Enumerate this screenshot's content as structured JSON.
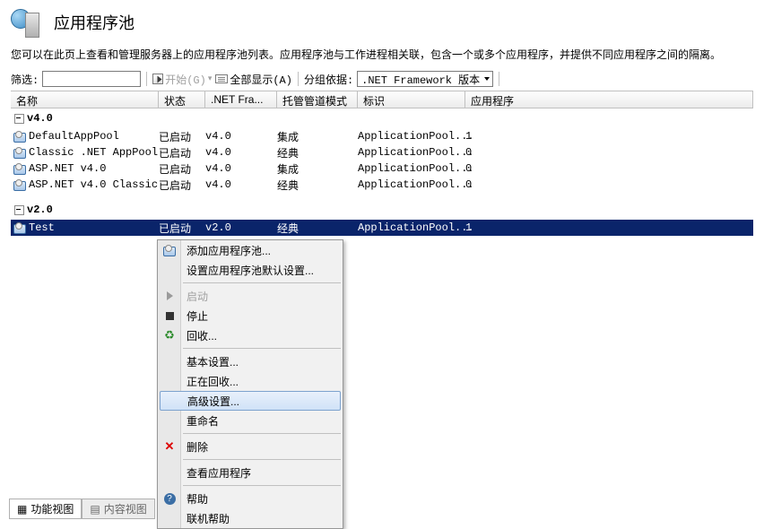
{
  "header": {
    "title": "应用程序池"
  },
  "description": "您可以在此页上查看和管理服务器上的应用程序池列表。应用程序池与工作进程相关联，包含一个或多个应用程序，并提供不同应用程序之间的隔离。",
  "toolbar": {
    "filter_label": "筛选:",
    "go_label": "开始(G)",
    "showall_label": "全部显示(A)",
    "groupby_label": "分组依据:",
    "groupby_value": ".NET Framework 版本"
  },
  "columns": {
    "name": "名称",
    "status": "状态",
    "net": ".NET Fra...",
    "pipe": "托管管道模式",
    "id": "标识",
    "apps": "应用程序"
  },
  "groups": {
    "g1": "v4.0",
    "g2": "v2.0"
  },
  "rows": [
    {
      "name": "DefaultAppPool",
      "status": "已启动",
      "net": "v4.0",
      "pipe": "集成",
      "id": "ApplicationPool...",
      "apps": "1"
    },
    {
      "name": "Classic .NET AppPool",
      "status": "已启动",
      "net": "v4.0",
      "pipe": "经典",
      "id": "ApplicationPool...",
      "apps": "0"
    },
    {
      "name": "ASP.NET v4.0",
      "status": "已启动",
      "net": "v4.0",
      "pipe": "集成",
      "id": "ApplicationPool...",
      "apps": "0"
    },
    {
      "name": "ASP.NET v4.0 Classic",
      "status": "已启动",
      "net": "v4.0",
      "pipe": "经典",
      "id": "ApplicationPool...",
      "apps": "0"
    },
    {
      "name": "Test",
      "status": "已启动",
      "net": "v2.0",
      "pipe": "经典",
      "id": "ApplicationPool...",
      "apps": "1"
    }
  ],
  "context_menu": {
    "add": "添加应用程序池...",
    "defaults": "设置应用程序池默认设置...",
    "start": "启动",
    "stop": "停止",
    "recycle": "回收...",
    "basic": "基本设置...",
    "recycling": "正在回收...",
    "advanced": "高级设置...",
    "rename": "重命名",
    "delete": "删除",
    "viewapps": "查看应用程序",
    "help": "帮助",
    "onlinehelp": "联机帮助"
  },
  "footer": {
    "features": "功能视图",
    "content": "内容视图"
  }
}
